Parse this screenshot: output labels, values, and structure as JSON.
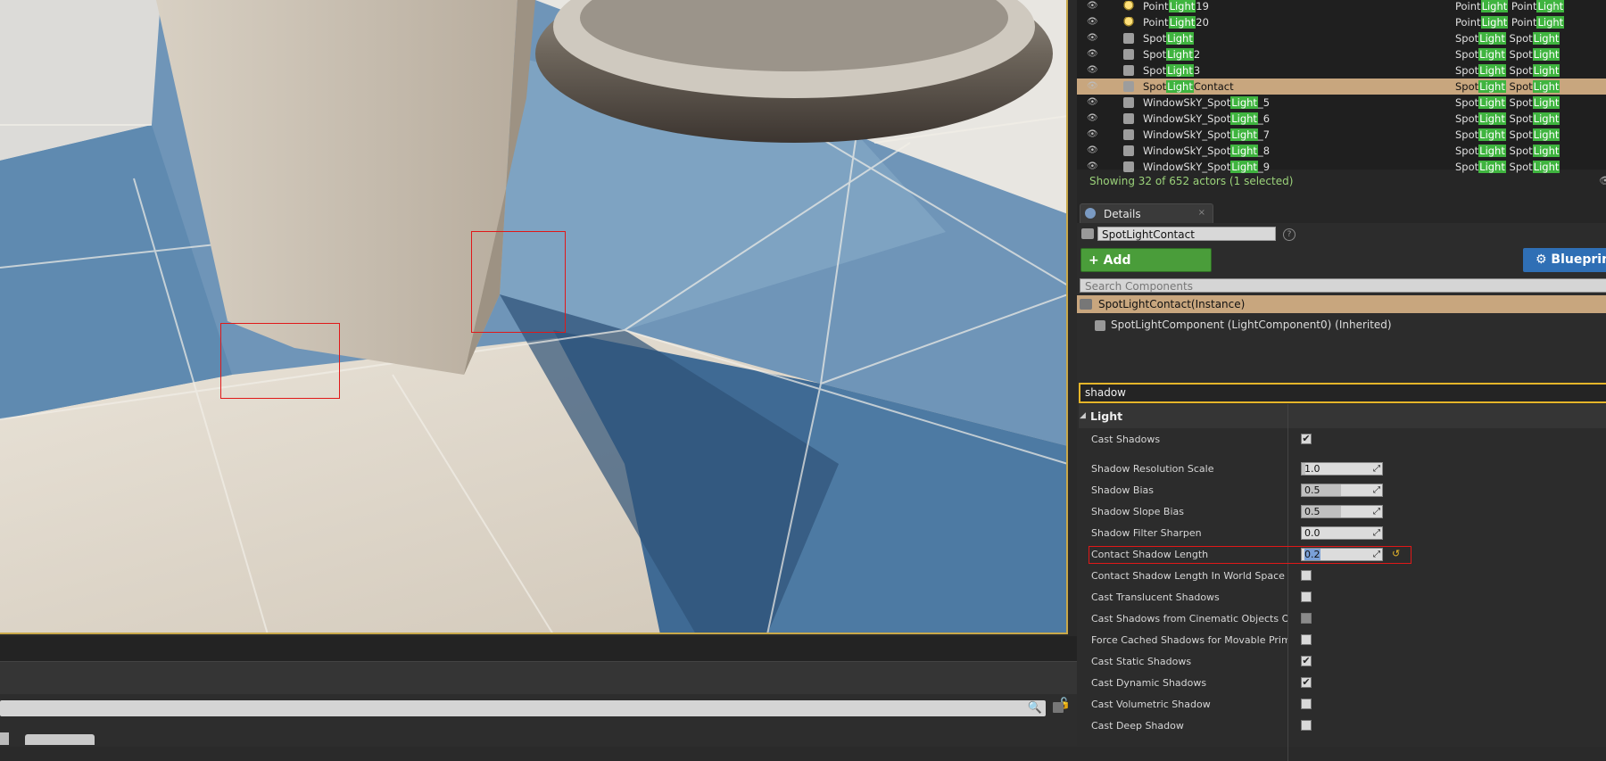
{
  "outliner": {
    "rows": [
      {
        "pre": "Point",
        "mid": "Light",
        "post": "19",
        "tpre": "Point",
        "tmid": "Light",
        "tpost": " Point",
        "tmid2": "Light",
        "selected": false,
        "bulb": true
      },
      {
        "pre": "Point",
        "mid": "Light",
        "post": "20",
        "tpre": "Point",
        "tmid": "Light",
        "tpost": " Point",
        "tmid2": "Light",
        "selected": false,
        "bulb": true
      },
      {
        "pre": "Spot",
        "mid": "Light",
        "post": "",
        "tpre": "Spot",
        "tmid": "Light",
        "tpost": " Spot",
        "tmid2": "Light",
        "selected": false,
        "bulb": false
      },
      {
        "pre": "Spot",
        "mid": "Light",
        "post": "2",
        "tpre": "Spot",
        "tmid": "Light",
        "tpost": " Spot",
        "tmid2": "Light",
        "selected": false,
        "bulb": false
      },
      {
        "pre": "Spot",
        "mid": "Light",
        "post": "3",
        "tpre": "Spot",
        "tmid": "Light",
        "tpost": " Spot",
        "tmid2": "Light",
        "selected": false,
        "bulb": false
      },
      {
        "pre": "Spot",
        "mid": "Light",
        "post": "Contact",
        "tpre": "Spot",
        "tmid": "Light",
        "tpost": " Spot",
        "tmid2": "Light",
        "selected": true,
        "bulb": false
      },
      {
        "pre": "WindowSkY_Spot",
        "mid": "Light",
        "post": "_5",
        "tpre": "Spot",
        "tmid": "Light",
        "tpost": " Spot",
        "tmid2": "Light",
        "selected": false,
        "bulb": false
      },
      {
        "pre": "WindowSkY_Spot",
        "mid": "Light",
        "post": "_6",
        "tpre": "Spot",
        "tmid": "Light",
        "tpost": " Spot",
        "tmid2": "Light",
        "selected": false,
        "bulb": false
      },
      {
        "pre": "WindowSkY_Spot",
        "mid": "Light",
        "post": "_7",
        "tpre": "Spot",
        "tmid": "Light",
        "tpost": " Spot",
        "tmid2": "Light",
        "selected": false,
        "bulb": false
      },
      {
        "pre": "WindowSkY_Spot",
        "mid": "Light",
        "post": "_8",
        "tpre": "Spot",
        "tmid": "Light",
        "tpost": " Spot",
        "tmid2": "Light",
        "selected": false,
        "bulb": false
      },
      {
        "pre": "WindowSkY_Spot",
        "mid": "Light",
        "post": "_9",
        "tpre": "Spot",
        "tmid": "Light",
        "tpost": " Spot",
        "tmid2": "Light",
        "selected": false,
        "bulb": false
      }
    ],
    "footer": "Showing 32 of 652 actors (1 selected)"
  },
  "details": {
    "tab_label": "Details",
    "tab_close": "×",
    "actor_name": "SpotLightContact",
    "help": "?",
    "add_component": "+ Add Component ▾",
    "blueprint": "⚙ Blueprint",
    "search_placeholder": "Search Components",
    "instance_label": "SpotLightContact(Instance)",
    "component_label": "SpotLightComponent (LightComponent0) (Inherited)",
    "filter_value": "shadow",
    "category": "Light",
    "category_arrow": "◢",
    "properties": [
      {
        "label": "Cast Shadows",
        "kind": "check",
        "checked": true
      },
      {
        "label": "Shadow Resolution Scale",
        "kind": "num",
        "value": "1.0",
        "fill": 0.05
      },
      {
        "label": "Shadow Bias",
        "kind": "num",
        "value": "0.5",
        "fill": 0.5
      },
      {
        "label": "Shadow Slope Bias",
        "kind": "num",
        "value": "0.5",
        "fill": 0.5
      },
      {
        "label": "Shadow Filter Sharpen",
        "kind": "num",
        "value": "0.0",
        "fill": 0
      },
      {
        "label": "Contact Shadow Length",
        "kind": "num",
        "value": "0.2",
        "fill": 0,
        "selected": true
      },
      {
        "label": "Contact Shadow Length In World Space Units",
        "kind": "check",
        "checked": false
      },
      {
        "label": "Cast Translucent Shadows",
        "kind": "check",
        "checked": false
      },
      {
        "label": "Cast Shadows from Cinematic Objects Only",
        "kind": "check",
        "checked": false,
        "dim": true
      },
      {
        "label": "Force Cached Shadows for Movable Primitives",
        "kind": "check",
        "checked": false
      },
      {
        "label": "Cast Static Shadows",
        "kind": "check",
        "checked": true
      },
      {
        "label": "Cast Dynamic Shadows",
        "kind": "check",
        "checked": true
      },
      {
        "label": "Cast Volumetric Shadow",
        "kind": "check",
        "checked": false
      },
      {
        "label": "Cast Deep Shadow",
        "kind": "check",
        "checked": false
      }
    ]
  },
  "icons": {
    "eye": "👁",
    "lock": "🔓",
    "search": "🔍",
    "check": "✔",
    "expand": "⤢",
    "reset": "↺"
  },
  "colors": {
    "selection": "#c8a67e",
    "highlight": "#3fb43f",
    "focus": "#e5b52a",
    "annotation": "#e01818"
  }
}
